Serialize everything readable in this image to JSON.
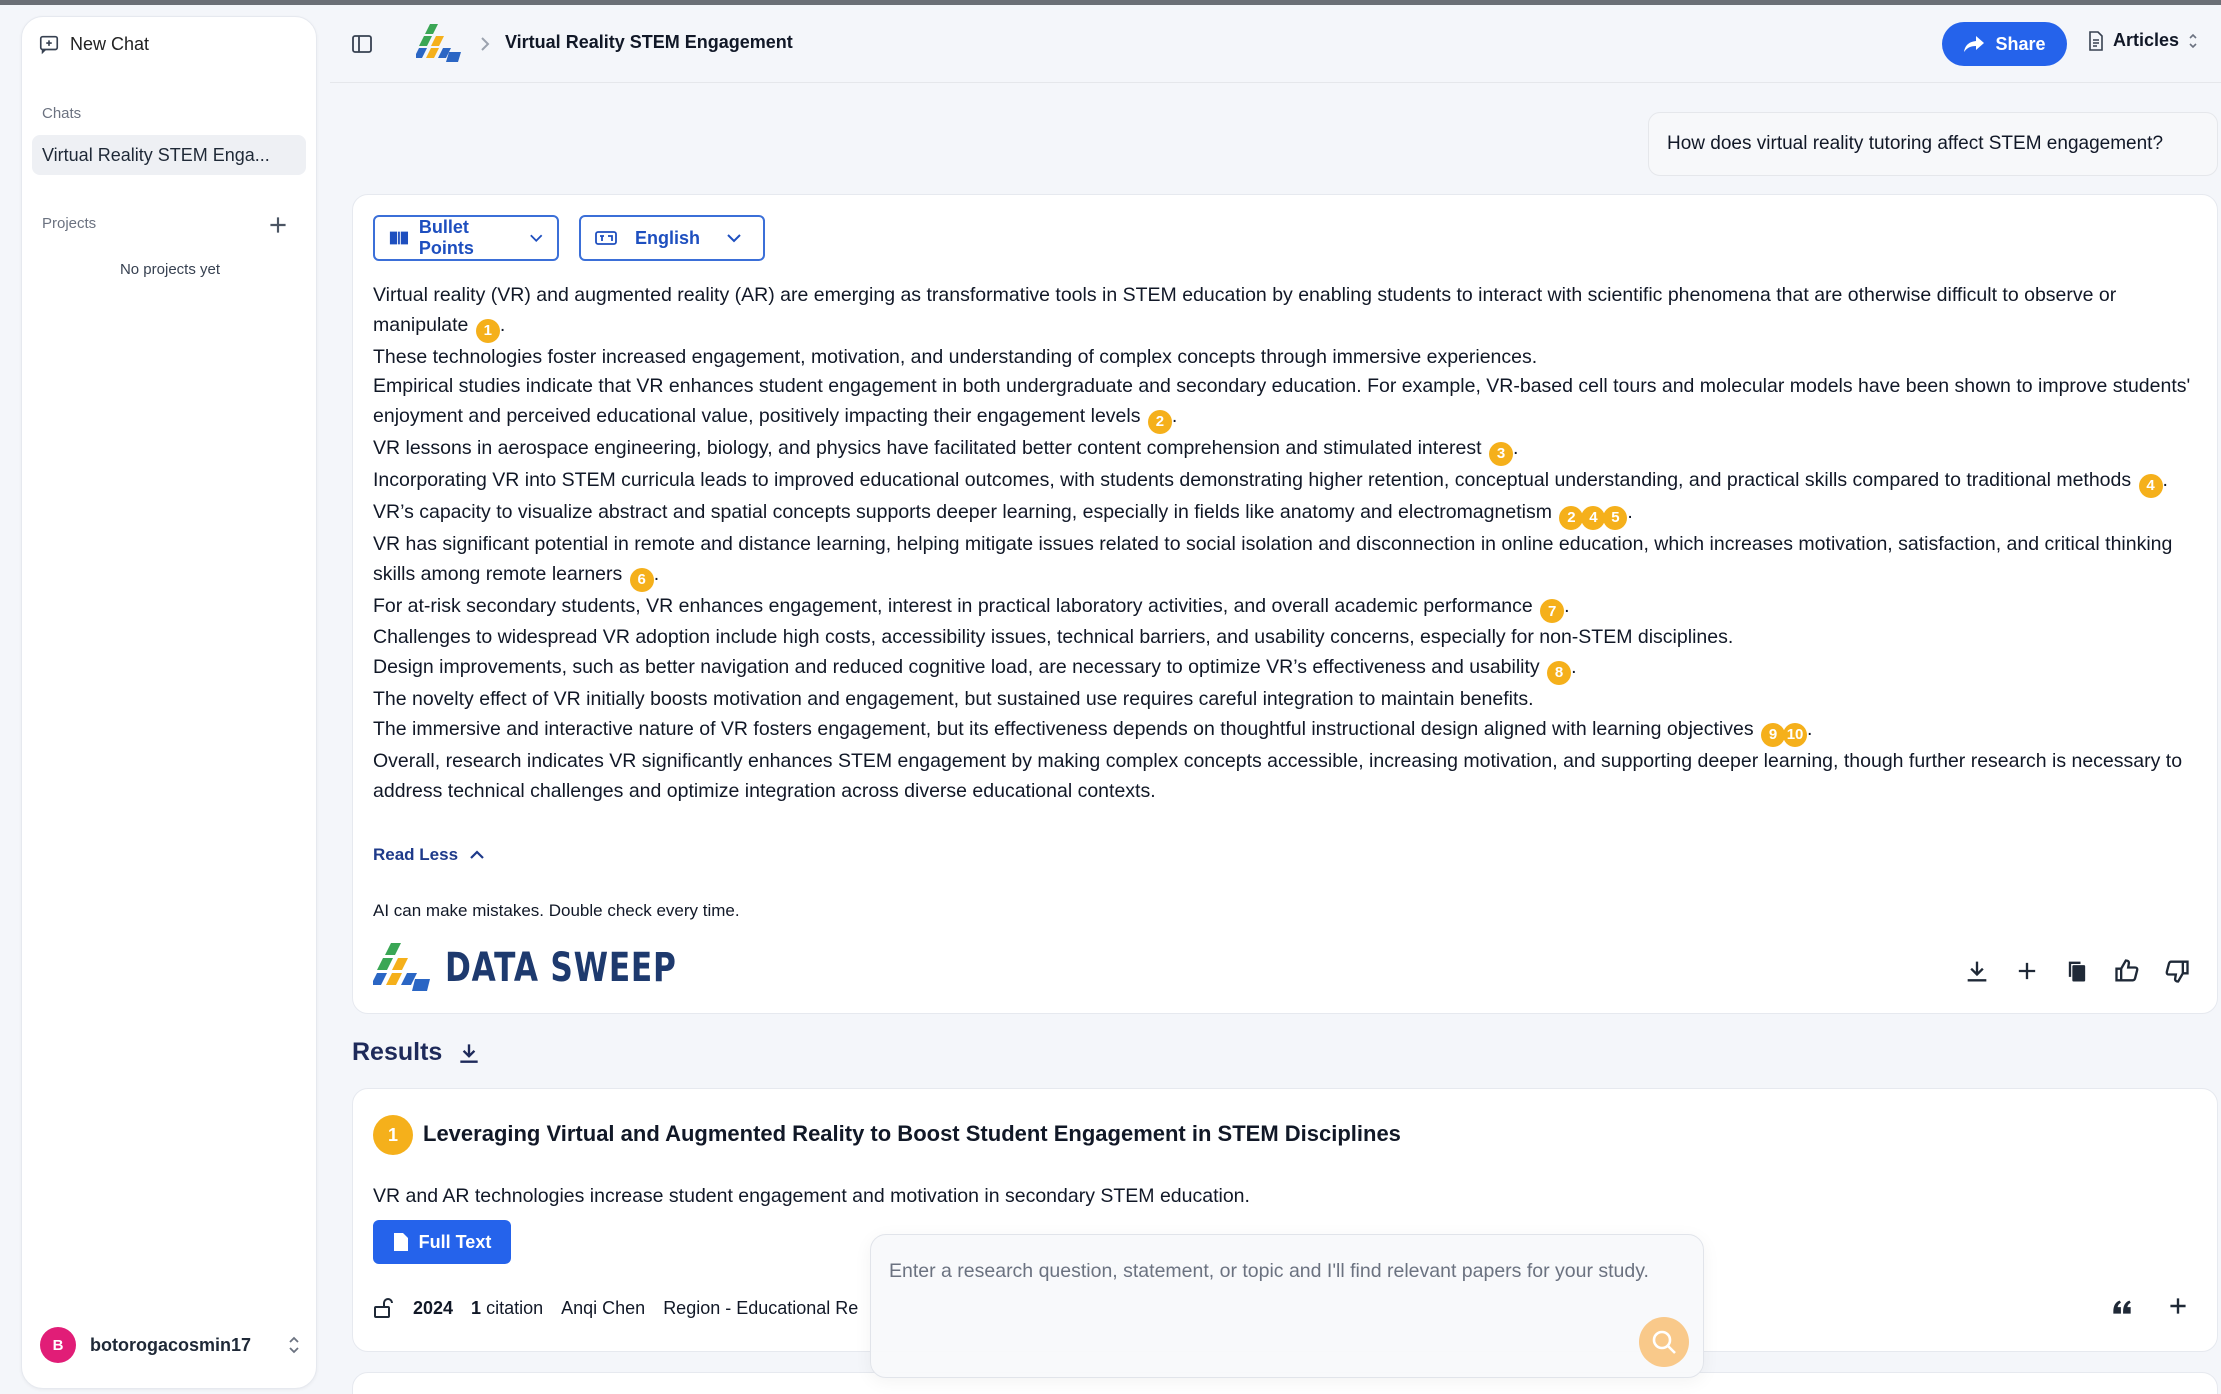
{
  "sidebar": {
    "new_chat_label": "New Chat",
    "chats_label": "Chats",
    "chats": [
      {
        "label": "Virtual Reality STEM Enga..."
      }
    ],
    "projects_label": "Projects",
    "no_projects": "No projects yet",
    "user": {
      "initial": "B",
      "name": "botorogacosmin17",
      "avatar_color": "#e11d77"
    }
  },
  "header": {
    "breadcrumb_title": "Virtual Reality STEM Engagement",
    "share_label": "Share",
    "articles_label": "Articles"
  },
  "question": "How does virtual reality tutoring affect STEM engagement?",
  "answer": {
    "format_label": "Bullet Points",
    "language_label": "English",
    "lines": [
      {
        "text": "Virtual reality (VR) and augmented reality (AR) are emerging as transformative tools in STEM education by enabling students to interact with scientific phenomena that are otherwise difficult to observe or manipulate",
        "cites": [
          "1"
        ]
      },
      {
        "text": "These technologies foster increased engagement, motivation, and understanding of complex concepts through immersive experiences.",
        "cites": []
      },
      {
        "text": "Empirical studies indicate that VR enhances student engagement in both undergraduate and secondary education. For example, VR-based cell tours and molecular models have been shown to improve students' enjoyment and perceived educational value, positively impacting their engagement levels",
        "cites": [
          "2"
        ]
      },
      {
        "text": "VR lessons in aerospace engineering, biology, and physics have facilitated better content comprehension and stimulated interest",
        "cites": [
          "3"
        ]
      },
      {
        "text": "Incorporating VR into STEM curricula leads to improved educational outcomes, with students demonstrating higher retention, conceptual understanding, and practical skills compared to traditional methods",
        "cites": [
          "4"
        ]
      },
      {
        "text": "VR’s capacity to visualize abstract and spatial concepts supports deeper learning, especially in fields like anatomy and electromagnetism",
        "cites": [
          "2",
          "4",
          "5"
        ]
      },
      {
        "text": "VR has significant potential in remote and distance learning, helping mitigate issues related to social isolation and disconnection in online education, which increases motivation, satisfaction, and critical thinking skills among remote learners",
        "cites": [
          "6"
        ]
      },
      {
        "text": "For at-risk secondary students, VR enhances engagement, interest in practical laboratory activities, and overall academic performance",
        "cites": [
          "7"
        ]
      },
      {
        "text": "Challenges to widespread VR adoption include high costs, accessibility issues, technical barriers, and usability concerns, especially for non-STEM disciplines.",
        "cites": []
      },
      {
        "text": "Design improvements, such as better navigation and reduced cognitive load, are necessary to optimize VR’s effectiveness and usability",
        "cites": [
          "8"
        ]
      },
      {
        "text": "The novelty effect of VR initially boosts motivation and engagement, but sustained use requires careful integration to maintain benefits.",
        "cites": []
      },
      {
        "text": "The immersive and interactive nature of VR fosters engagement, but its effectiveness depends on thoughtful instructional design aligned with learning objectives",
        "cites": [
          "9",
          "10"
        ]
      },
      {
        "text": "Overall, research indicates VR significantly enhances STEM engagement by making complex concepts accessible, increasing motivation, and supporting deeper learning, though further research is necessary to address technical challenges and optimize integration across diverse educational contexts.",
        "cites": []
      }
    ],
    "read_less_label": "Read Less",
    "disclaimer": "AI can make mistakes. Double check every time.",
    "brand_name": "DATA SWEEP"
  },
  "results": {
    "title": "Results",
    "items": [
      {
        "number": "1",
        "title": "Leveraging Virtual and Augmented Reality to Boost Student Engagement in STEM Disciplines",
        "summary": "VR and AR technologies increase student engagement and motivation in secondary STEM education.",
        "full_text_label": "Full Text",
        "year": "2024",
        "citations": "1",
        "citations_suffix": "citation",
        "author": "Anqi Chen",
        "journal": "Region - Educational Re"
      }
    ]
  },
  "search": {
    "placeholder": "Enter a research question, statement, or topic and I'll find relevant papers for your study."
  },
  "colors": {
    "accent": "#2563eb",
    "citation": "#f5b01b",
    "brand_navy": "#1e3a6e"
  }
}
